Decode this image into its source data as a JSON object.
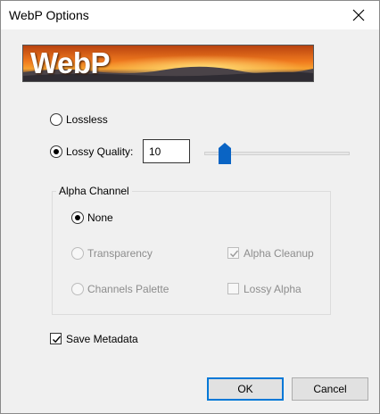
{
  "window": {
    "title": "WebP Options"
  },
  "banner": {
    "logo_text": "WebP"
  },
  "compression": {
    "lossless_label": "Lossless",
    "lossy_label": "Lossy Quality:",
    "quality_value": "10",
    "quality_slider_fraction": 0.1
  },
  "alpha_channel": {
    "group_title": "Alpha Channel",
    "none_label": "None",
    "transparency_label": "Transparency",
    "channels_palette_label": "Channels Palette",
    "alpha_cleanup_label": "Alpha Cleanup",
    "lossy_alpha_label": "Lossy Alpha"
  },
  "save_metadata_label": "Save Metadata",
  "buttons": {
    "ok": "OK",
    "cancel": "Cancel"
  },
  "colors": {
    "accent": "#0078d7",
    "slider_thumb": "#0a64c4",
    "disabled_text": "#8d8d8d"
  }
}
